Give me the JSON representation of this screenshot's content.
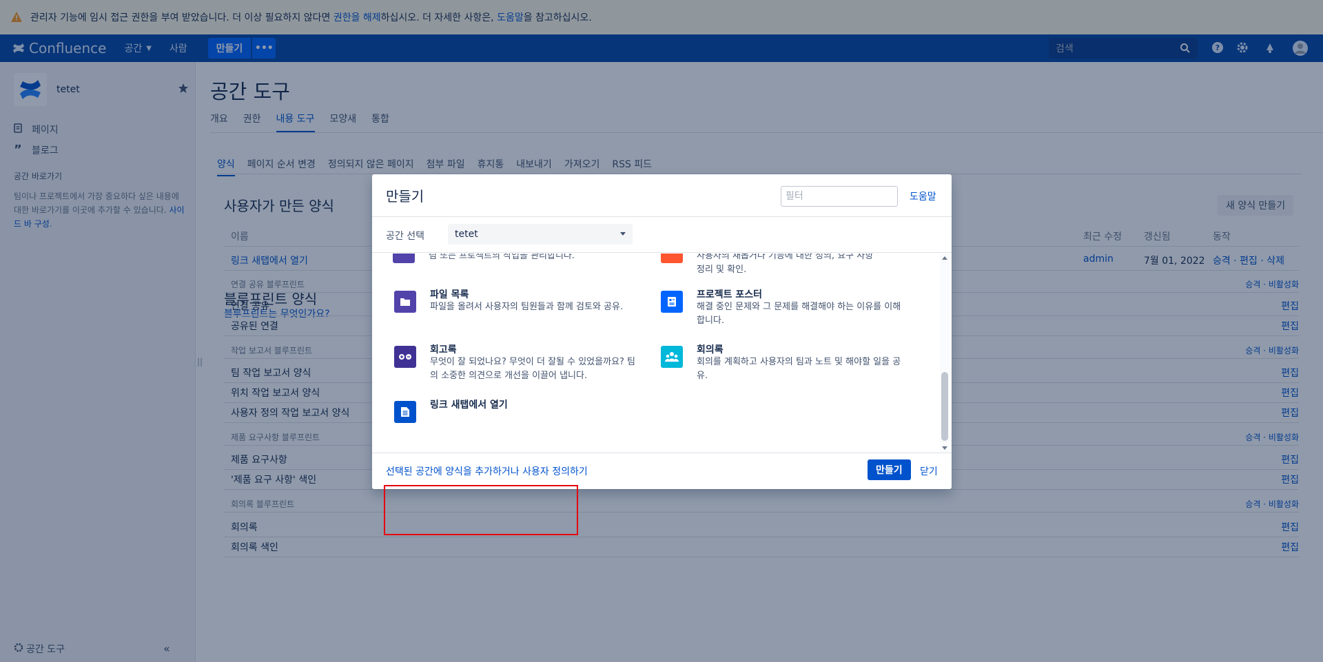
{
  "banner": {
    "part1": "관리자 기능에 임시 접근 권한을 부여 받았습니다. 더 이상 필요하지 않다면 ",
    "link1": "권한을 해제",
    "part2": "하십시오. 더 자세한 사항은, ",
    "link2": "도움말",
    "part3": "을 참고하십시오."
  },
  "topnav": {
    "brand": "Confluence",
    "spaces": "공간",
    "people": "사람",
    "create": "만들기",
    "more": "•••",
    "search_placeholder": "검색"
  },
  "sidebar": {
    "space_name": "tetet",
    "links": [
      "페이지",
      "블로그"
    ],
    "shortcut_title": "공간 바로가기",
    "shortcut_desc": "팀이나 프로젝트에서 가장 중요하다 싶은 내용에 대한 바로가기를 이곳에 추가할 수 있습니다. ",
    "shortcut_link": "사이드 바 구성",
    "shortcut_end": ".",
    "tools": "공간 도구",
    "collapse": "«"
  },
  "main": {
    "title": "공간 도구",
    "tabs": [
      "개요",
      "권한",
      "내용 도구",
      "모양새",
      "통합"
    ],
    "subtabs": [
      "양식",
      "페이지 순서 변경",
      "정의되지 않은 페이지",
      "첨부 파일",
      "휴지통",
      "내보내기",
      "가져오기",
      "RSS 피드"
    ],
    "user_templates_title": "사용자가 만든 양식",
    "new_template": "새 양식 만들기",
    "columns": {
      "name": "이름",
      "modified": "최근 수정",
      "updated": "갱신됨",
      "actions": "동작"
    },
    "user_row": {
      "name": "링크 새탭에서 열기",
      "modified": "admin",
      "updated": "7월 01, 2022",
      "actions": "승격 · 편집 · 삭제"
    },
    "blueprints_title": "블루프린트 양식",
    "blueprints_link": "블루프린트는 무엇인가요?",
    "group_action": "승격 · 비활성화",
    "edit": "편집",
    "groups": [
      {
        "title": "연결 공유 블루프린트",
        "items": [
          "연결 공유",
          "공유된 연결"
        ]
      },
      {
        "title": "작업 보고서 블루프린트",
        "items": [
          "팀 작업 보고서 양식",
          "위치 작업 보고서 양식",
          "사용자 정의 작업 보고서 양식"
        ]
      },
      {
        "title": "제품 요구사항 블루프린트",
        "items": [
          "제품 요구사항",
          "'제품 요구 사항' 색인"
        ]
      },
      {
        "title": "회의록 블루프린트",
        "items": [
          "회의록",
          "회의록 색인"
        ]
      }
    ]
  },
  "dialog": {
    "title": "만들기",
    "filter_placeholder": "필터",
    "help": "도움말",
    "space_label": "공간 선택",
    "space_value": "tetet",
    "partial_left": "팀 또는 프로젝트의 작업을 관리합니다.",
    "partial_right_1": "사용자의 새롭거나 기능에 대한 정의, 요구 사항",
    "partial_right_2": "정리 및 확인.",
    "items": [
      {
        "name": "파일 목록",
        "desc": "파일을 올려서 사용자의 팀원들과 함께 검토와 공유.",
        "color": "#5243aa",
        "icon": "folder-icon"
      },
      {
        "name": "프로젝트 포스터",
        "desc": "해결 중인 문제와 그 문제를 해결해야 하는 이유를 이해합니다.",
        "color": "#0065ff",
        "icon": "poster-icon"
      },
      {
        "name": "회고록",
        "desc": "무엇이 잘 되었나요? 무엇이 더 잘될 수 있었을까요? 팀의 소중한 의견으로 개선을 이끌어 냅니다.",
        "color": "#403294",
        "icon": "retro-icon"
      },
      {
        "name": "회의록",
        "desc": "회의를 계획하고 사용자의 팀과 노트 및 해야할 일을 공유.",
        "color": "#00b8d9",
        "icon": "meeting-icon"
      },
      {
        "name": "링크 새탭에서 열기",
        "desc": "",
        "color": "#0052cc",
        "icon": "document-icon"
      }
    ],
    "footer_link": "선택된 공간에 양식을 추가하거나 사용자 정의하기",
    "create": "만들기",
    "close": "닫기"
  },
  "colors": {
    "nav": "#0747a6",
    "accent": "#0052cc",
    "highlight": "#e5000e",
    "banner": "#fffae6"
  }
}
